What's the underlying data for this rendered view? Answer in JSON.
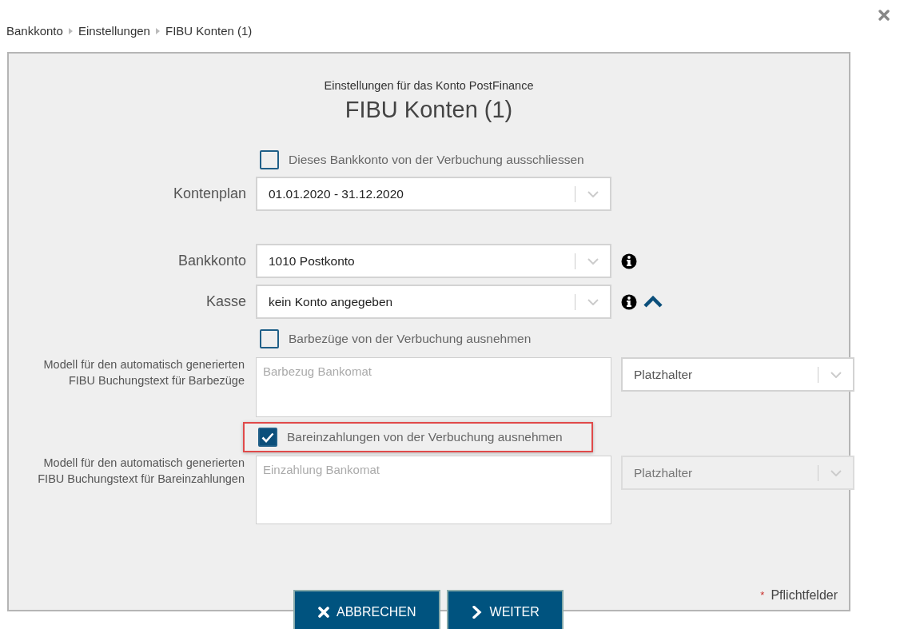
{
  "breadcrumb": [
    "Bankkonto",
    "Einstellungen",
    "FIBU Konten (1)"
  ],
  "subtitle": "Einstellungen für das Konto PostFinance",
  "title": "FIBU Konten (1)",
  "form": [
    {
      "kind": "checkbox",
      "label": "Dieses Bankkonto von der Verbuchung ausschliessen",
      "checked": false,
      "highlighted": false
    },
    {
      "kind": "select",
      "label": "Kontenplan",
      "value": "01.01.2020 - 31.12.2020",
      "info": false,
      "collapse_toggle": false
    },
    {
      "kind": "select",
      "label": "Bankkonto",
      "value": "1010 Postkonto",
      "info": true,
      "collapse_toggle": false
    },
    {
      "kind": "select",
      "label": "Kasse",
      "value": "kein Konto angegeben",
      "info": true,
      "collapse_toggle": true
    },
    {
      "kind": "checkbox",
      "label": "Barbezüge von der Verbuchung ausnehmen",
      "checked": false,
      "highlighted": false
    },
    {
      "kind": "template",
      "label": "Modell für den automatisch generierten FIBU Buchungstext für Barbezüge",
      "placeholder": "Barbezug Bankomat",
      "side_select": {
        "placeholder": "Platzhalter",
        "disabled": false
      }
    },
    {
      "kind": "checkbox",
      "label": "Bareinzahlungen von der Verbuchung ausnehmen",
      "checked": true,
      "highlighted": true
    },
    {
      "kind": "template",
      "label": "Modell für den automatisch generierten FIBU Buchungstext für Bareinzahlungen",
      "placeholder": "Einzahlung Bankomat",
      "side_select": {
        "placeholder": "Platzhalter",
        "disabled": true
      }
    }
  ],
  "required_note": {
    "marker": "*",
    "text": "Pflichtfelder"
  },
  "buttons": [
    {
      "kind": "cancel",
      "label": "ABBRECHEN"
    },
    {
      "kind": "next",
      "label": "WEITER"
    }
  ]
}
